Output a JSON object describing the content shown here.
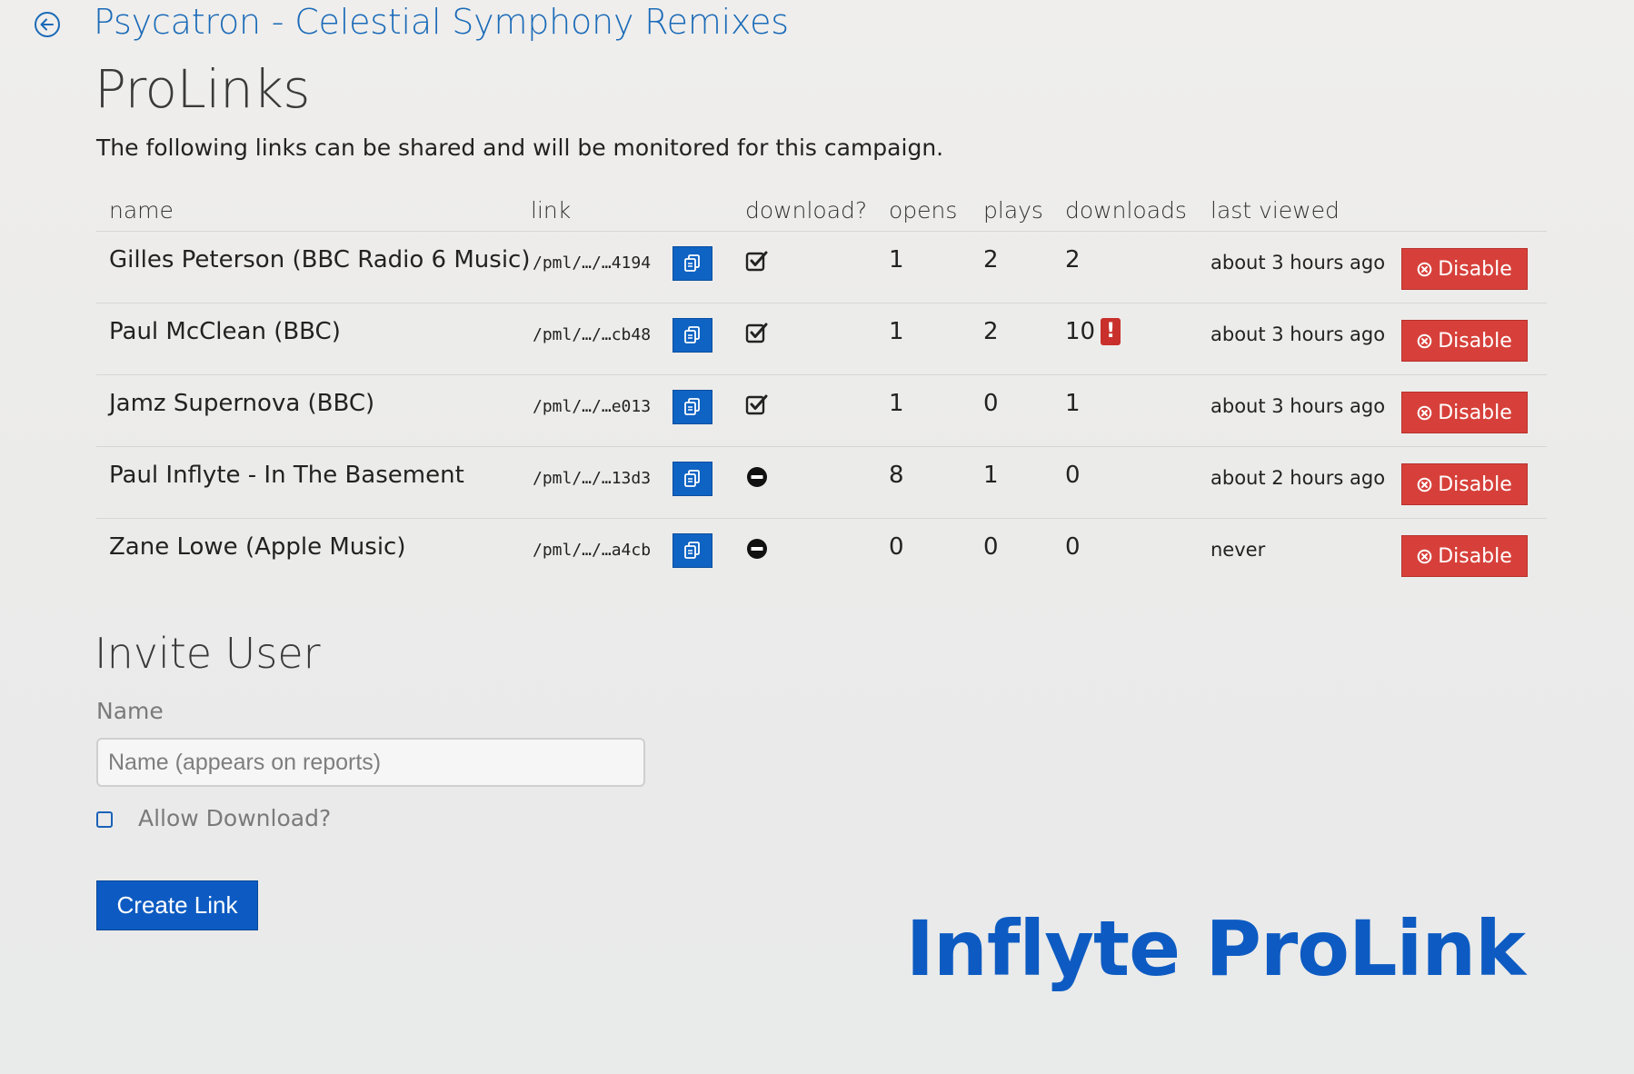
{
  "header": {
    "campaign_title": "Psycatron - Celestial Symphony Remixes",
    "page_title": "ProLinks",
    "description": "The following links can be shared and will be monitored for this campaign."
  },
  "table": {
    "columns": {
      "name": "name",
      "link": "link",
      "download": "download?",
      "opens": "opens",
      "plays": "plays",
      "downloads": "downloads",
      "last_viewed": "last viewed"
    },
    "disable_label": "Disable",
    "rows": [
      {
        "name": "Gilles Peterson (BBC Radio 6 Music)",
        "link": "/pml/…/…4194",
        "download_allowed": true,
        "opens": "1",
        "plays": "2",
        "downloads": "2",
        "warning": false,
        "last_viewed": "about 3 hours ago"
      },
      {
        "name": "Paul McClean (BBC)",
        "link": "/pml/…/…cb48",
        "download_allowed": true,
        "opens": "1",
        "plays": "2",
        "downloads": "10",
        "warning": true,
        "last_viewed": "about 3 hours ago"
      },
      {
        "name": "Jamz Supernova (BBC)",
        "link": "/pml/…/…e013",
        "download_allowed": true,
        "opens": "1",
        "plays": "0",
        "downloads": "1",
        "warning": false,
        "last_viewed": "about 3 hours ago"
      },
      {
        "name": "Paul Inflyte - In The Basement",
        "link": "/pml/…/…13d3",
        "download_allowed": false,
        "opens": "8",
        "plays": "1",
        "downloads": "0",
        "warning": false,
        "last_viewed": "about 2 hours ago"
      },
      {
        "name": "Zane Lowe (Apple Music)",
        "link": "/pml/…/…a4cb",
        "download_allowed": false,
        "opens": "0",
        "plays": "0",
        "downloads": "0",
        "warning": false,
        "last_viewed": "never"
      }
    ]
  },
  "invite": {
    "title": "Invite User",
    "name_label": "Name",
    "name_value": "",
    "name_placeholder": "Name (appears on reports)",
    "allow_download_label": "Allow Download?",
    "allow_download_checked": false,
    "create_button": "Create Link"
  },
  "brand": {
    "text": "Inflyte ProLink"
  },
  "colors": {
    "accent_blue": "#0d5bc2",
    "title_blue": "#1a6ab8",
    "danger_red": "#d7403a",
    "warning_red": "#c9302c"
  },
  "icons": {
    "back": "back-arrow-circle-icon",
    "copy": "copy-clipboard-icon",
    "download_allowed": "checked-box-icon",
    "download_blocked": "minus-circle-icon",
    "disable": "x-circle-icon",
    "warning": "exclamation-icon"
  }
}
